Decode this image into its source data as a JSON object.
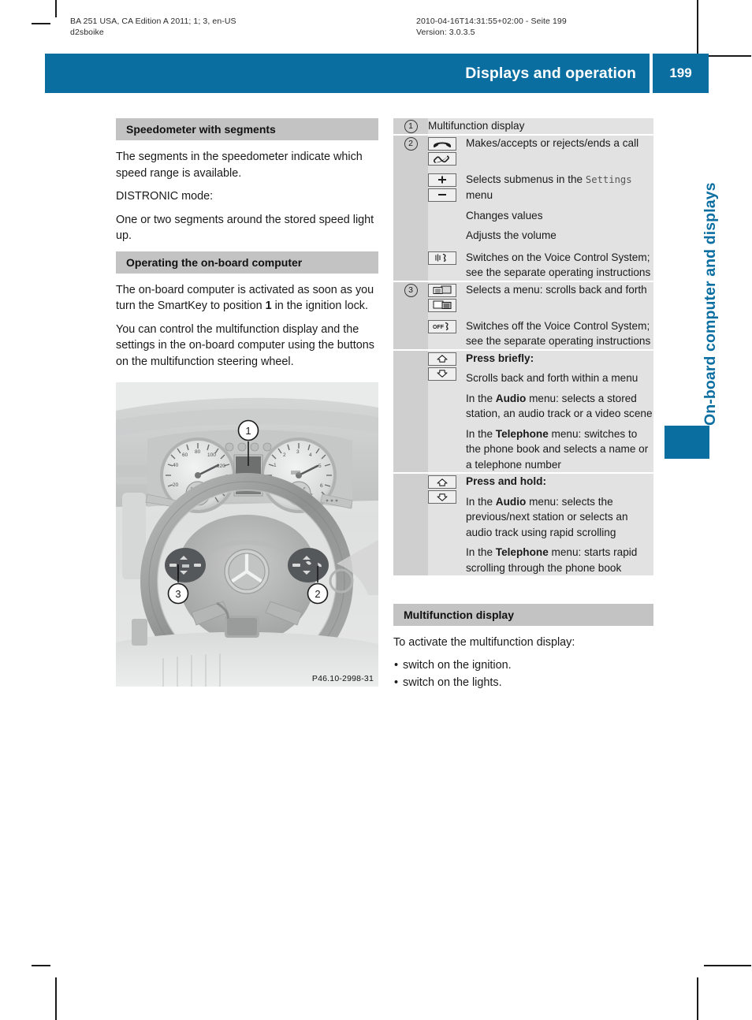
{
  "running_header": {
    "left_line1": "BA 251 USA, CA Edition A 2011; 1; 3, en-US",
    "left_line2": "d2sboike",
    "right_line1": "2010-04-16T14:31:55+02:00 - Seite 199",
    "right_line2": "Version: 3.0.3.5"
  },
  "header_bar": {
    "chapter_title": "Displays and operation",
    "page_number": "199",
    "accent_color": "#0a6ea1"
  },
  "side_tab": {
    "label": "On-board computer and displays",
    "color": "#0a6ea1"
  },
  "left_column": {
    "section1": {
      "heading": "Speedometer with segments",
      "paragraphs": [
        "The segments in the speedometer indicate which speed range is available.",
        "DISTRONIC mode:",
        "One or two segments around the stored speed light up."
      ]
    },
    "section2": {
      "heading": "Operating the on-board computer",
      "paragraph1_a": "The on-board computer is activated as soon as you turn the SmartKey to position ",
      "paragraph1_bold": "1",
      "paragraph1_b": " in the ignition lock.",
      "paragraph2": "You can control the multifunction display and the settings in the on-board computer using the buttons on the multifunction steering wheel."
    },
    "figure": {
      "caption": "P46.10-2998-31",
      "callouts": [
        "1",
        "2",
        "3"
      ],
      "alt": "Mercedes-Benz multifunction steering wheel with instrument cluster"
    }
  },
  "control_table": {
    "rows": [
      {
        "number": "1",
        "entries": [
          {
            "icons": [],
            "text": "Multifunction display"
          }
        ]
      },
      {
        "number": "2",
        "entries": [
          {
            "icons": [
              "phone-hangup-icon",
              "phone-pickup-icon"
            ],
            "text": "Makes/accepts or rejects/ends a call"
          },
          {
            "icons": [
              "plus-icon",
              "minus-icon"
            ],
            "text_a": "Selects submenus in the ",
            "text_mono": "Settings",
            "text_b": " menu",
            "sub_lines": [
              "Changes values",
              "Adjusts the volume"
            ]
          },
          {
            "icons": [
              "voice-control-on-icon"
            ],
            "text": "Switches on the Voice Control System; see the separate operating instructions"
          }
        ]
      },
      {
        "number": "3",
        "entries": [
          {
            "icons": [
              "menu-scroll-back-icon",
              "menu-scroll-forth-icon"
            ],
            "text": "Selects a menu: scrolls back and forth"
          },
          {
            "icons": [
              "voice-control-off-icon"
            ],
            "text": "Switches off the Voice Control System; see the separate operating instructions"
          }
        ]
      },
      {
        "number": "",
        "entries": [
          {
            "icons": [
              "arrow-up-icon",
              "arrow-down-icon"
            ],
            "bold_lead": "Press briefly:",
            "sub_lines": [
              "Scrolls back and forth within a menu"
            ],
            "rich_lines": [
              {
                "pre": "In the ",
                "bold": "Audio",
                "post": " menu: selects a stored station, an audio track or a video scene"
              },
              {
                "pre": "In the ",
                "bold": "Telephone",
                "post": " menu: switches to the phone book and selects a name or a telephone number"
              }
            ]
          }
        ]
      },
      {
        "number": "",
        "entries": [
          {
            "icons": [
              "arrow-up-icon",
              "arrow-down-icon"
            ],
            "bold_lead": "Press and hold:",
            "sub_lines": [],
            "rich_lines": [
              {
                "pre": "In the ",
                "bold": "Audio",
                "post": " menu: selects the previous/next station or selects an audio track using rapid scrolling"
              },
              {
                "pre": "In the ",
                "bold": "Telephone",
                "post": " menu: starts rapid scrolling through the phone book"
              }
            ]
          }
        ]
      }
    ]
  },
  "right_column_bottom": {
    "heading": "Multifunction display",
    "intro": "To activate the multifunction display:",
    "bullets": [
      "switch on the ignition.",
      "switch on the lights."
    ]
  }
}
